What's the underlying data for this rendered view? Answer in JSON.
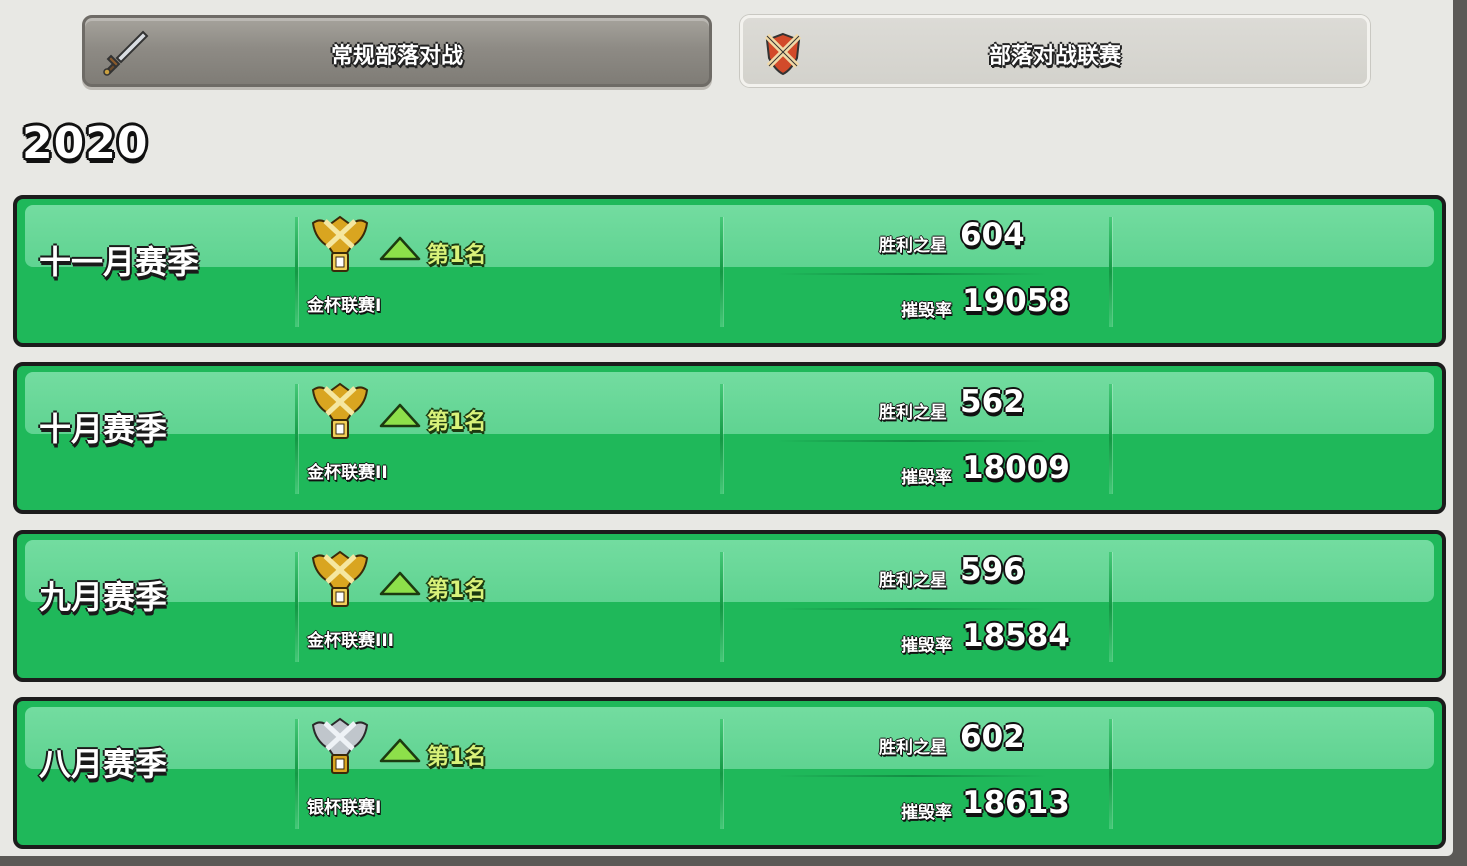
{
  "tabs": {
    "regular_label": "常规部落对战",
    "league_label": "部落对战联赛"
  },
  "year": "2020",
  "stars_label": "胜利之星",
  "destruction_label": "摧毁率",
  "seasons": [
    {
      "name": "十一月赛季",
      "rank": "第1名",
      "league": "金杯联赛I",
      "badge_tier": "gold",
      "stars": "604",
      "destruction": "19058"
    },
    {
      "name": "十月赛季",
      "rank": "第1名",
      "league": "金杯联赛II",
      "badge_tier": "gold",
      "stars": "562",
      "destruction": "18009"
    },
    {
      "name": "九月赛季",
      "rank": "第1名",
      "league": "金杯联赛III",
      "badge_tier": "gold",
      "stars": "596",
      "destruction": "18584"
    },
    {
      "name": "八月赛季",
      "rank": "第1名",
      "league": "银杯联赛I",
      "badge_tier": "silver",
      "stars": "602",
      "destruction": "18613"
    }
  ],
  "icons": {
    "regular_tab": "sword-icon",
    "league_tab": "crossed-swords-shield-icon",
    "rank_arrow": "up-arrow-icon"
  },
  "colors": {
    "row_green": "#1fb85a",
    "rank_text": "#d9f27a",
    "gold": "#d9a520",
    "silver": "#c0c6cc"
  }
}
